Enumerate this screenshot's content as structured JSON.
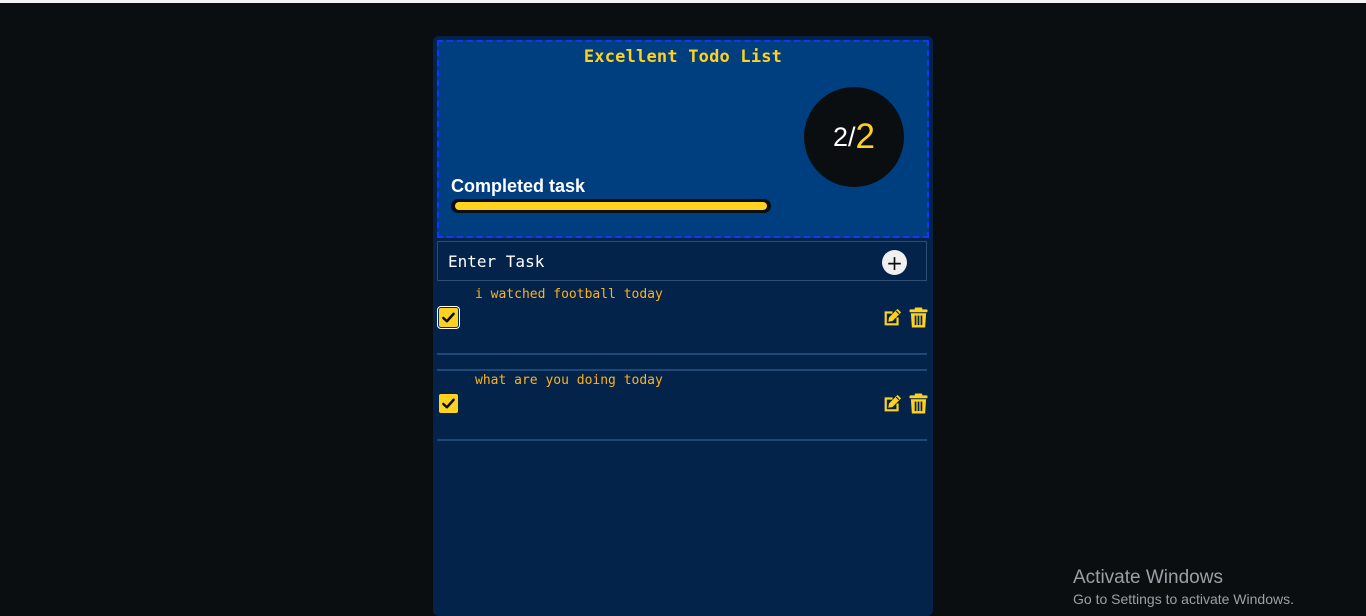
{
  "app": {
    "title": "Excellent Todo List",
    "completed_label": "Completed task",
    "progress": 1.0,
    "counter": {
      "done": "2",
      "slash": "/",
      "total": "2"
    }
  },
  "input": {
    "placeholder": "Enter Task",
    "add_icon": "plus-icon",
    "add_symbol": "+"
  },
  "tasks": [
    {
      "text": "i watched football today",
      "completed": true
    },
    {
      "text": "what are you doing today",
      "completed": true
    }
  ],
  "watermark": {
    "title": "Activate Windows",
    "subtitle": "Go to Settings to activate Windows."
  },
  "colors": {
    "accent": "#ffd21f",
    "task_text": "#ffb21a",
    "header_bg": "#003f7f",
    "panel_bg": "#03234b",
    "page_bg": "#0b0e10"
  }
}
